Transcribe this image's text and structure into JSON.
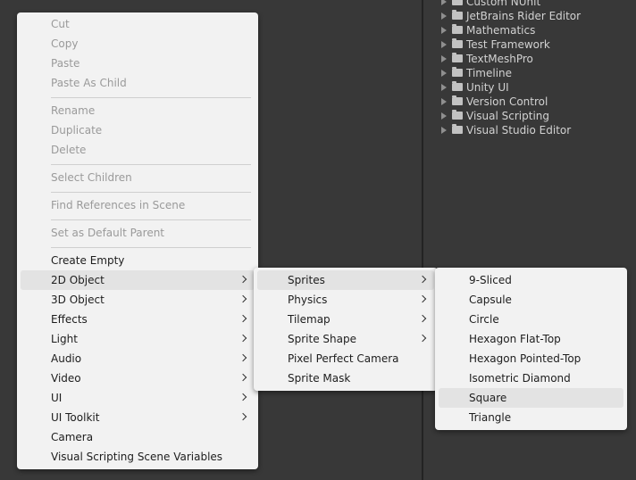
{
  "project_tree": [
    "Custom NUnit",
    "JetBrains Rider Editor",
    "Mathematics",
    "Test Framework",
    "TextMeshPro",
    "Timeline",
    "Unity UI",
    "Version Control",
    "Visual Scripting",
    "Visual Studio Editor"
  ],
  "context_menu": {
    "cut": "Cut",
    "copy": "Copy",
    "paste": "Paste",
    "paste_as_child": "Paste As Child",
    "rename": "Rename",
    "duplicate": "Duplicate",
    "delete": "Delete",
    "select_children": "Select Children",
    "find_references": "Find References in Scene",
    "set_default_parent": "Set as Default Parent",
    "create_empty": "Create Empty",
    "object_2d": "2D Object",
    "object_3d": "3D Object",
    "effects": "Effects",
    "light": "Light",
    "audio": "Audio",
    "video": "Video",
    "ui": "UI",
    "ui_toolkit": "UI Toolkit",
    "camera": "Camera",
    "visual_scripting_scene_variables": "Visual Scripting Scene Variables"
  },
  "submenu_2d": {
    "sprites": "Sprites",
    "physics": "Physics",
    "tilemap": "Tilemap",
    "sprite_shape": "Sprite Shape",
    "pixel_perfect_camera": "Pixel Perfect Camera",
    "sprite_mask": "Sprite Mask"
  },
  "submenu_sprites": {
    "nine_sliced": "9-Sliced",
    "capsule": "Capsule",
    "circle": "Circle",
    "hexagon_flat_top": "Hexagon Flat-Top",
    "hexagon_pointed_top": "Hexagon Pointed-Top",
    "isometric_diamond": "Isometric Diamond",
    "square": "Square",
    "triangle": "Triangle"
  }
}
